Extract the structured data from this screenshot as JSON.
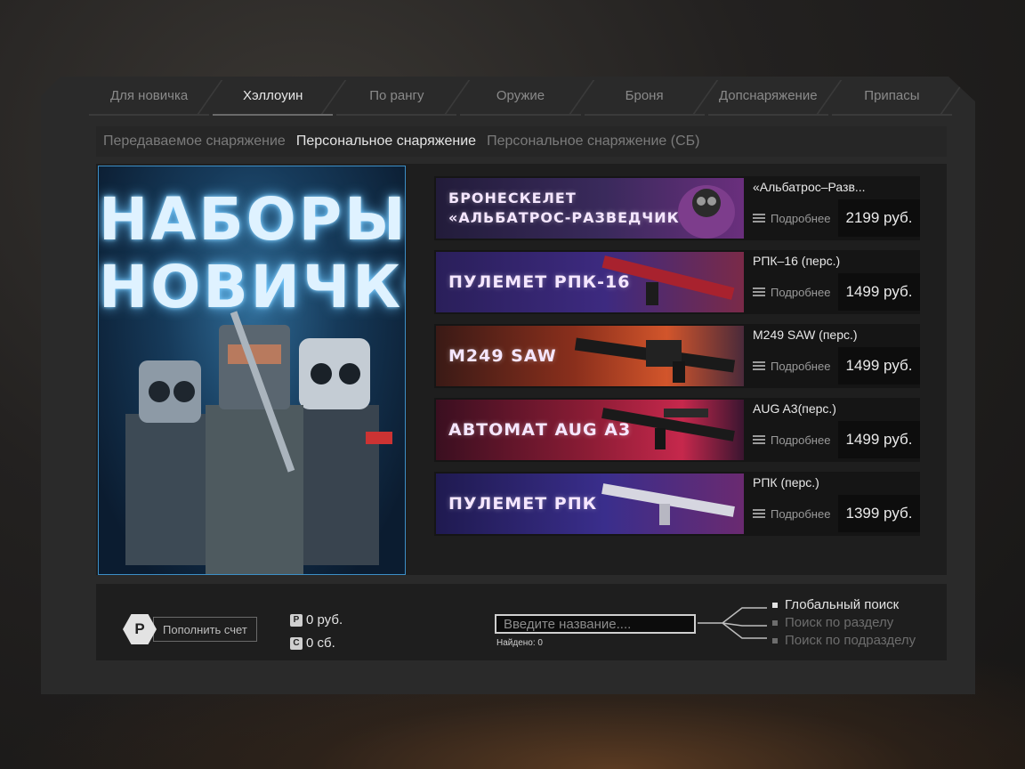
{
  "tabs": [
    {
      "label": "Для новичка"
    },
    {
      "label": "Хэллоуин",
      "active": true
    },
    {
      "label": "По рангу"
    },
    {
      "label": "Оружие"
    },
    {
      "label": "Броня"
    },
    {
      "label": "Допснаряжение"
    },
    {
      "label": "Припасы"
    }
  ],
  "subtabs": [
    {
      "label": "Передаваемое снаряжение"
    },
    {
      "label": "Персональное снаряжение",
      "active": true
    },
    {
      "label": "Персональное снаряжение (СБ)"
    }
  ],
  "promo": {
    "title_line1": "НАБОРЫ",
    "title_line2": "НОВИЧКОВ"
  },
  "offers": [
    {
      "banner": "БРОНЕСКЕЛЕТ\n«АЛЬБАТРОС-РАЗВЕДЧИК»",
      "name": "«Альбатрос–Разв...",
      "details": "Подробнее",
      "price": "2199 руб.",
      "accent": "#7b3fa0"
    },
    {
      "banner": "ПУЛЕМЕТ РПК-16",
      "name": "РПК–16 (перс.)",
      "details": "Подробнее",
      "price": "1499 руб.",
      "accent": "#5a2fa8"
    },
    {
      "banner": "M249 SAW",
      "name": "M249 SAW (перс.)",
      "details": "Подробнее",
      "price": "1499 руб.",
      "accent": "#d9542a"
    },
    {
      "banner": "АВТОМАТ AUG A3",
      "name": "AUG A3(перс.)",
      "details": "Подробнее",
      "price": "1499 руб.",
      "accent": "#c4244a"
    },
    {
      "banner": "ПУЛЕМЕТ РПК",
      "name": "РПК (перс.)",
      "details": "Подробнее",
      "price": "1399 руб.",
      "accent": "#4c3ab0"
    }
  ],
  "footer": {
    "currency_symbol": "Р",
    "topup_label": "Пополнить счет",
    "balance_rub": "0 руб.",
    "balance_sb": "0 сб.",
    "search_placeholder": "Введите название....",
    "found_label": "Найдено: 0",
    "search_options": [
      {
        "label": "Глобальный поиск",
        "active": true
      },
      {
        "label": "Поиск по разделу"
      },
      {
        "label": "Поиск по подразделу"
      }
    ]
  }
}
